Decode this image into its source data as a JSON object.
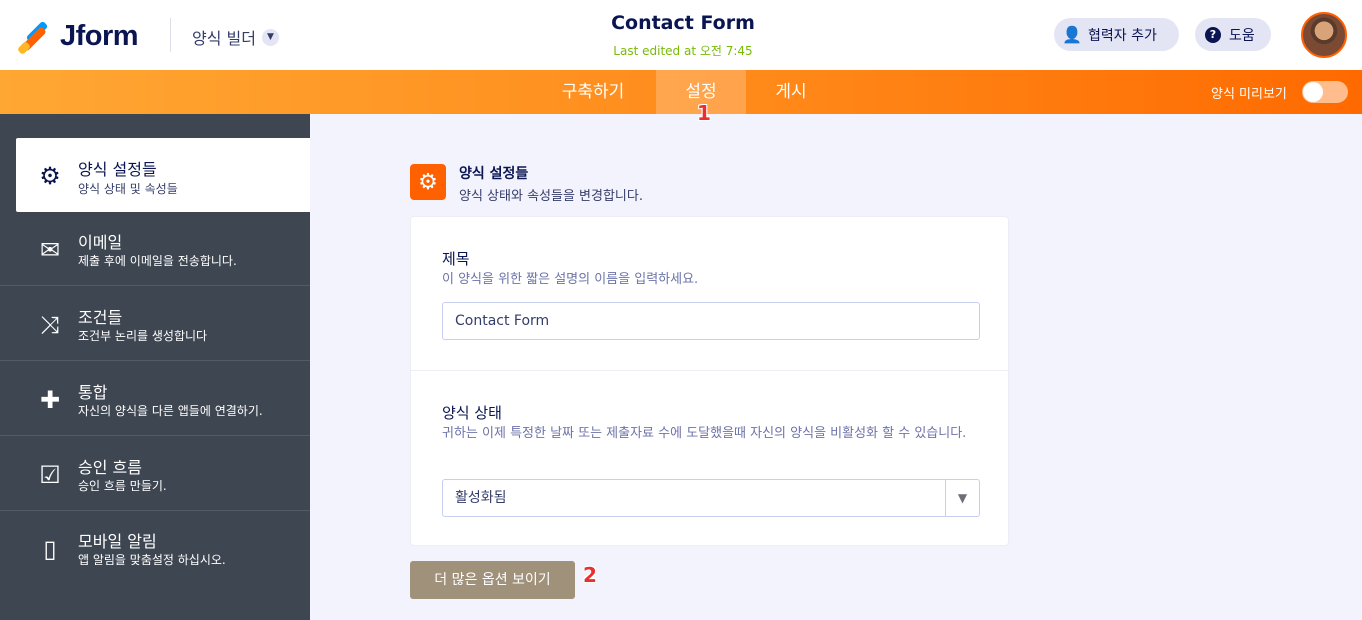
{
  "header": {
    "logo_text": "Jform",
    "builder_label": "양식 빌더",
    "form_title": "Contact Form",
    "last_edited": "Last edited at 오전 7:45",
    "collab_button": "협력자 추가",
    "help_button": "도움"
  },
  "nav": {
    "tabs": [
      {
        "label": "구축하기"
      },
      {
        "label": "설정"
      },
      {
        "label": "게시"
      }
    ],
    "active_tab": "설정",
    "preview_label": "양식 미리보기",
    "preview_on": false,
    "marker1": "1",
    "marker2": "2"
  },
  "sidebar": {
    "items": [
      {
        "title": "양식 설정들",
        "sub": "양식 상태 및 속성들",
        "icon": "gear-icon"
      },
      {
        "title": "이메일",
        "sub": "제출 후에 이메일을 전송합니다.",
        "icon": "envelope-icon"
      },
      {
        "title": "조건들",
        "sub": "조건부 논리를 생성합니다",
        "icon": "shuffle-icon"
      },
      {
        "title": "통합",
        "sub": "자신의 양식을 다른 앱들에 연결하기.",
        "icon": "puzzle-icon"
      },
      {
        "title": "승인 흐름",
        "sub": "승인 흐름 만들기.",
        "icon": "approval-icon"
      },
      {
        "title": "모바일 알림",
        "sub": "앱 알림을 맞춤설정 하십시오.",
        "icon": "mobile-icon"
      }
    ]
  },
  "main": {
    "section_title": "양식 설정들",
    "section_sub": "양식 상태와 속성들을 변경합니다.",
    "title_label": "제목",
    "title_help": "이 양식을 위한 짧은 설명의 이름을 입력하세요.",
    "title_value": "Contact Form",
    "status_label": "양식 상태",
    "status_help": "귀하는 이제 특정한 날짜 또는 제출자료 수에 도달했을때 자신의 양식을 비활성화 할 수 있습니다.",
    "status_value": "활성화됨",
    "more_button": "더 많은 옵션 보이기"
  },
  "colors": {
    "accent": "#ff6100",
    "nav_start": "#ffa733",
    "sidebar_bg": "#3e4652",
    "edited_green": "#78bb07",
    "more_button_bg": "#a0917a"
  }
}
